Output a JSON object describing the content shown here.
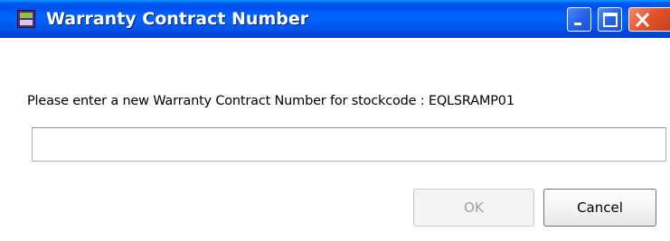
{
  "window": {
    "title": "Warranty Contract Number",
    "app_icon": "dialog-app-icon",
    "controls": {
      "minimize_icon": "minimize-icon",
      "maximize_icon": "maximize-icon",
      "close_icon": "close-icon"
    }
  },
  "dialog": {
    "prompt": "Please enter a new Warranty Contract Number for stockcode : EQLSRAMP01",
    "input_value": "",
    "input_placeholder": "",
    "ok_label": "OK",
    "ok_enabled": false,
    "cancel_label": "Cancel"
  },
  "colors": {
    "titlebar": "#0058ee",
    "close_button": "#e2522b",
    "disabled_text": "#a0a0a0"
  }
}
